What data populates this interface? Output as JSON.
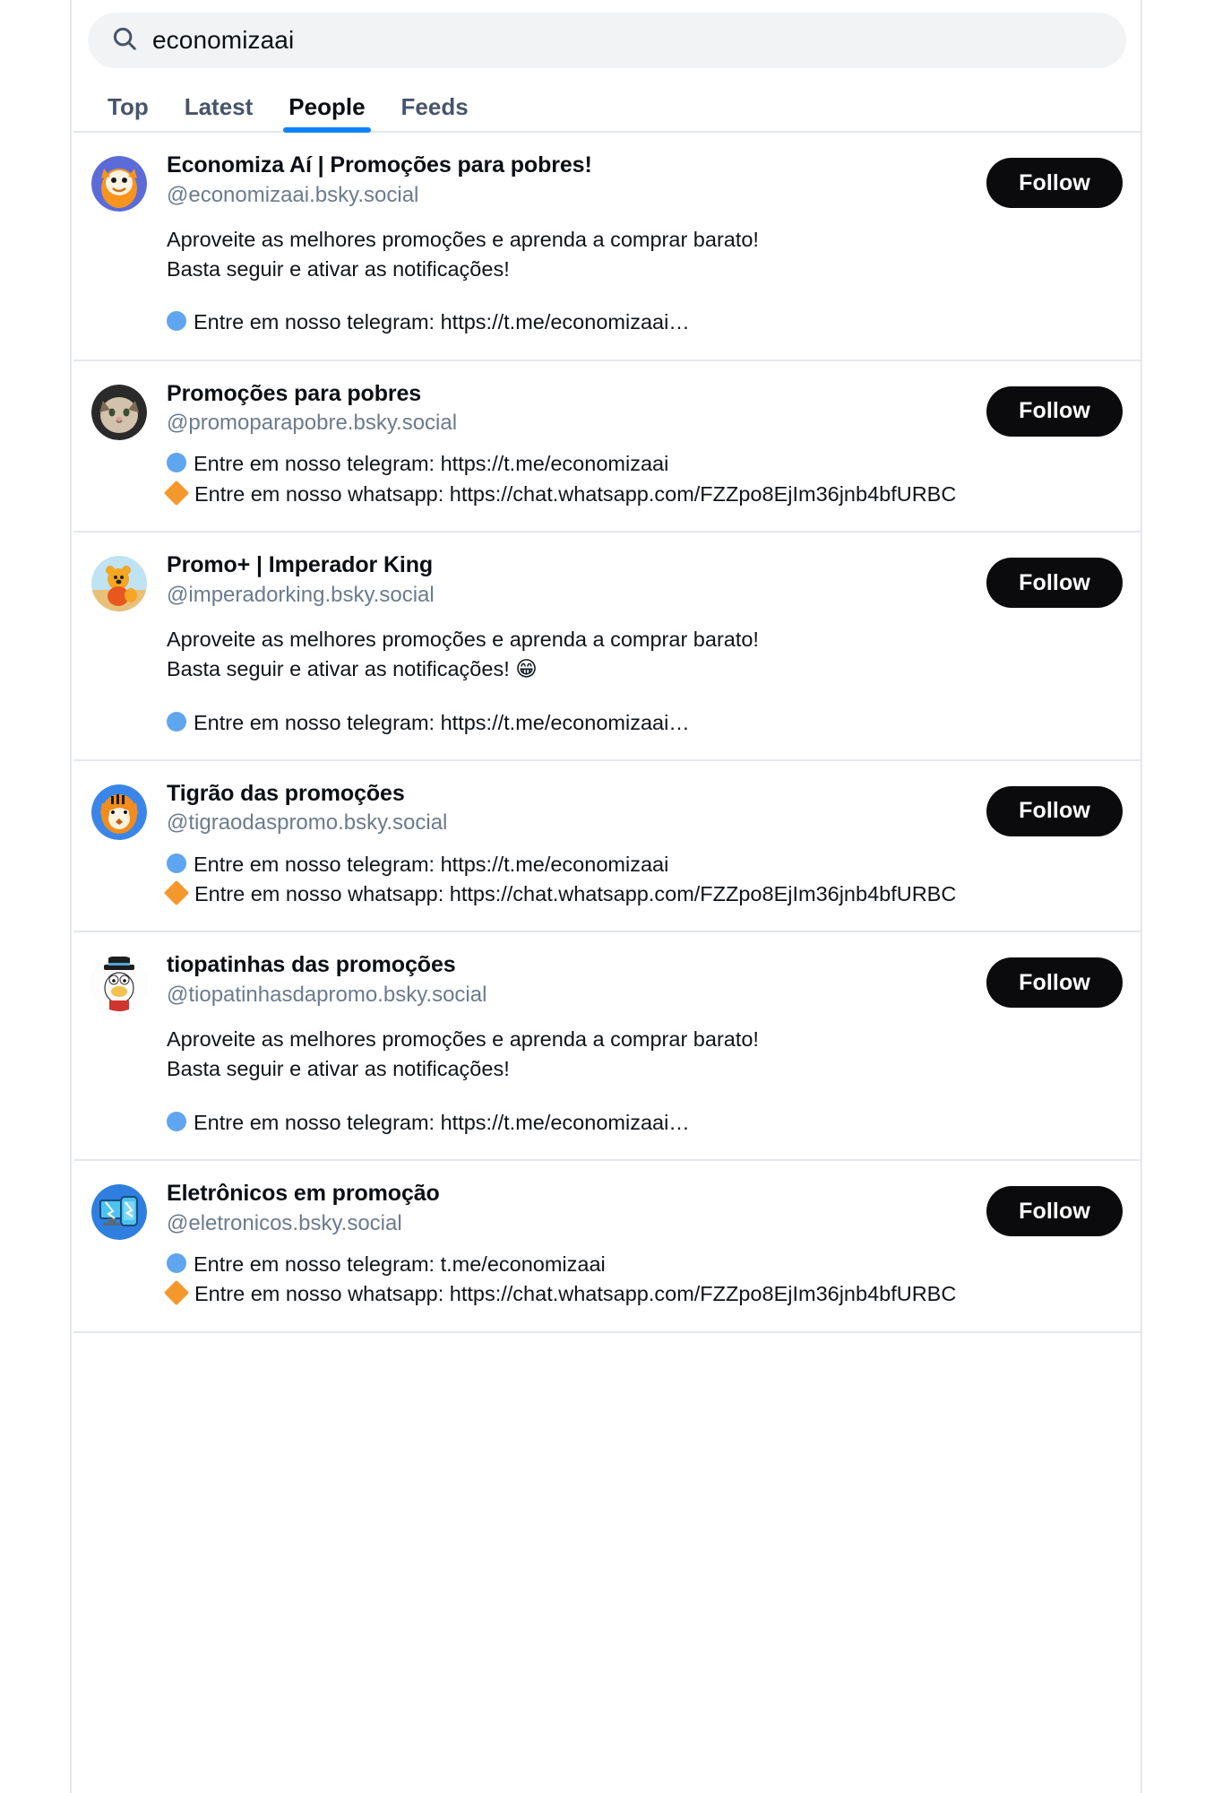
{
  "search": {
    "value": "economizaai",
    "placeholder": "Search",
    "icon": "search-icon"
  },
  "tabs": [
    {
      "label": "Top",
      "active": false
    },
    {
      "label": "Latest",
      "active": false
    },
    {
      "label": "People",
      "active": true
    },
    {
      "label": "Feeds",
      "active": false
    }
  ],
  "colors": {
    "accent": "#1083fe",
    "follow_button_bg": "#0b0b0d",
    "follow_button_text": "#ffffff",
    "handle_text": "#6b7b8e",
    "tab_inactive": "#46556a",
    "search_bg": "#f1f3f5",
    "divider": "#e4e8ed",
    "bullet_blue": "#60a5f0",
    "bullet_orange": "#f5982b"
  },
  "follow_label": "Follow",
  "results": [
    {
      "display_name": "Economiza Aí | Promoções para pobres!",
      "handle": "@economizaai.bsky.social",
      "avatar": "garfield-avatar",
      "bio_top": "Aproveite as melhores promoções e aprenda a comprar barato!\nBasta seguir e ativar as notificações!",
      "bio_lines": [
        {
          "bullet": "blue-circle",
          "text": "Entre em nosso telegram: https://t.me/economizaai…"
        }
      ]
    },
    {
      "display_name": "Promoções para pobres",
      "handle": "@promoparapobre.bsky.social",
      "avatar": "cat-avatar",
      "bio_top": "",
      "bio_lines": [
        {
          "bullet": "blue-circle",
          "text": "Entre em nosso telegram: https://t.me/economizaai"
        },
        {
          "bullet": "orange-diamond",
          "text": "Entre em nosso whatsapp: https://chat.whatsapp.com/FZZpo8EjIm36jnb4bfURBC"
        }
      ]
    },
    {
      "display_name": "Promo+ | Imperador King",
      "handle": "@imperadorking.bsky.social",
      "avatar": "pooh-avatar",
      "bio_top": "Aproveite as melhores promoções e aprenda a comprar barato!\nBasta seguir e ativar as notificações! 😁",
      "bio_lines": [
        {
          "bullet": "blue-circle",
          "text": "Entre em nosso telegram: https://t.me/economizaai…"
        }
      ]
    },
    {
      "display_name": "Tigrão das promoções",
      "handle": "@tigraodaspromo.bsky.social",
      "avatar": "tiger-avatar",
      "bio_top": "",
      "bio_lines": [
        {
          "bullet": "blue-circle",
          "text": "Entre em nosso telegram: https://t.me/economizaai"
        },
        {
          "bullet": "orange-diamond",
          "text": "Entre em nosso whatsapp: https://chat.whatsapp.com/FZZpo8EjIm36jnb4bfURBC"
        }
      ]
    },
    {
      "display_name": "tiopatinhas das promoções",
      "handle": "@tiopatinhasdapromo.bsky.social",
      "avatar": "scrooge-avatar",
      "bio_top": "Aproveite as melhores promoções e aprenda a comprar barato!\nBasta seguir e ativar as notificações!",
      "bio_lines": [
        {
          "bullet": "blue-circle",
          "text": "Entre em nosso telegram: https://t.me/economizaai…"
        }
      ]
    },
    {
      "display_name": "Eletrônicos em promoção",
      "handle": "@eletronicos.bsky.social",
      "avatar": "devices-avatar",
      "bio_top": "",
      "bio_lines": [
        {
          "bullet": "blue-circle",
          "text": "Entre em nosso telegram: t.me/economizaai"
        },
        {
          "bullet": "orange-diamond",
          "text": "Entre em nosso whatsapp: https://chat.whatsapp.com/FZZpo8EjIm36jnb4bfURBC"
        }
      ]
    }
  ]
}
